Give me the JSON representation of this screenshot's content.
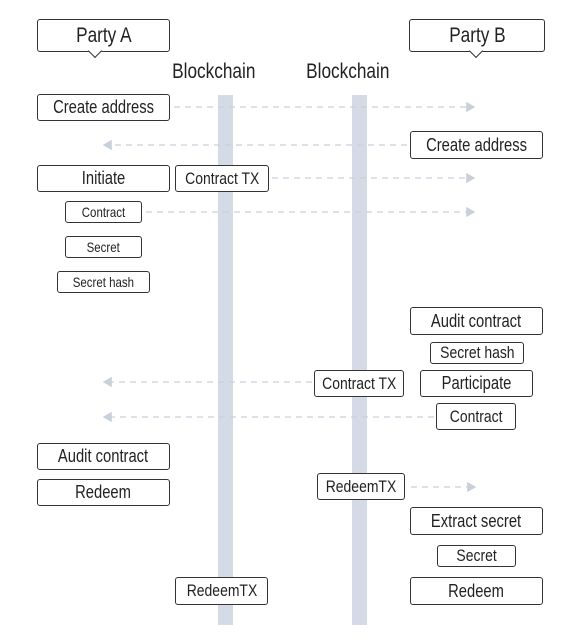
{
  "parties": {
    "a": "Party A",
    "b": "Party B"
  },
  "blockchains": {
    "left": "Blockchain",
    "right": "Blockchain"
  },
  "party_a_steps": {
    "create_address": "Create address",
    "initiate": "Initiate",
    "contract": "Contract",
    "secret": "Secret",
    "secret_hash": "Secret hash",
    "audit_contract": "Audit contract",
    "redeem": "Redeem"
  },
  "party_b_steps": {
    "create_address": "Create address",
    "audit_contract": "Audit contract",
    "secret_hash": "Secret hash",
    "participate": "Participate",
    "contract": "Contract",
    "extract_secret": "Extract secret",
    "secret": "Secret",
    "redeem": "Redeem"
  },
  "transactions": {
    "contract_tx_left": "Contract TX",
    "contract_tx_right": "Contract TX",
    "redeem_tx_right": "RedeemTX",
    "redeem_tx_left": "RedeemTX"
  },
  "colors": {
    "lane": "#d4dbe6",
    "arrow": "#c9d0da",
    "border": "#333333"
  }
}
